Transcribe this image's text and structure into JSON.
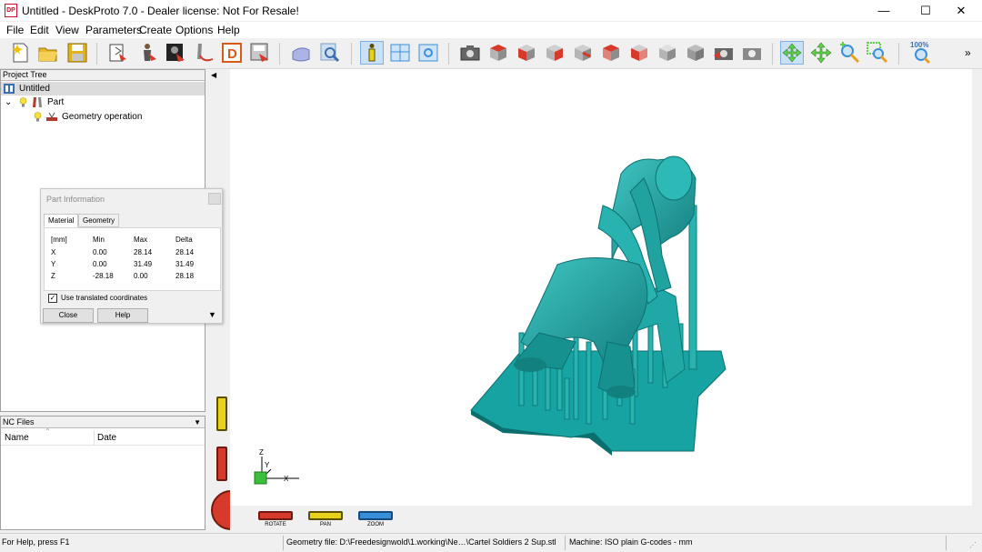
{
  "window": {
    "title": "Untitled - DeskProto 7.0 - Dealer license: Not For Resale!",
    "app_icon_text": "DP",
    "minimize": "—",
    "maximize": "☐",
    "close": "✕"
  },
  "menu": [
    "File",
    "Edit",
    "View",
    "Parameters",
    "Create",
    "Options",
    "Help"
  ],
  "toolbar": {
    "zoom_label": "100%",
    "overflow": "»"
  },
  "project_tree": {
    "header": "Project Tree",
    "root": "Untitled",
    "part": "Part",
    "operation": "Geometry operation"
  },
  "nc_files": {
    "header": "NC Files",
    "columns": [
      "Name",
      "Date"
    ]
  },
  "part_info": {
    "title": "Part Information",
    "tabs": [
      "Material",
      "Geometry"
    ],
    "headers": [
      "[mm]",
      "Min",
      "Max",
      "Delta"
    ],
    "rows": [
      [
        "X",
        "0.00",
        "28.14",
        "28.14"
      ],
      [
        "Y",
        "0.00",
        "31.49",
        "31.49"
      ],
      [
        "Z",
        "-28.18",
        "0.00",
        "28.18"
      ]
    ],
    "checkbox_label": "Use translated coordinates",
    "checkbox_checked": true,
    "close_button": "Close",
    "help_button": "Help"
  },
  "view_controls": {
    "rotate": "ROTATE",
    "pan": "PAN",
    "zoom": "ZOOM"
  },
  "axes": {
    "z": "Z",
    "y": "Y",
    "x": "X"
  },
  "status": {
    "help": "For Help, press F1",
    "geometry": "Geometry file: D:\\Freedesignwold\\1.working\\Ne…\\Cartel Soldiers 2 Sup.stl",
    "machine": "Machine: ISO plain G-codes - mm"
  },
  "colors": {
    "model": "#1a9a9a",
    "model_dark": "#0f6f70",
    "accent_red": "#d63a2a",
    "accent_yellow": "#e8d21c",
    "accent_blue": "#3a8fd9"
  }
}
